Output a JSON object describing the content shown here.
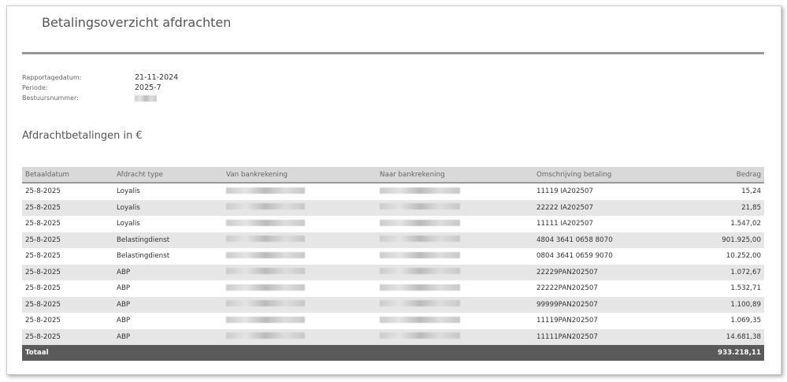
{
  "title": "Betalingsoverzicht afdrachten",
  "meta": {
    "rapportagedatum_label": "Rapportagedatum:",
    "rapportagedatum": "21-11-2024",
    "periode_label": "Periode:",
    "periode": "2025-7",
    "bestuursnummer_label": "Bestuursnummer:"
  },
  "section_title": "Afdrachtbetalingen in €",
  "columns": [
    "Betaaldatum",
    "Afdracht type",
    "Van bankrekening",
    "Naar bankrekening",
    "Omschrijving betaling",
    "Bedrag"
  ],
  "rows": [
    {
      "datum": "25-8-2025",
      "type": "Loyalis",
      "omschrijving": "11119 IA202507",
      "bedrag": "15,24"
    },
    {
      "datum": "25-8-2025",
      "type": "Loyalis",
      "omschrijving": "22222 IA202507",
      "bedrag": "21,85"
    },
    {
      "datum": "25-8-2025",
      "type": "Loyalis",
      "omschrijving": "11111 IA202507",
      "bedrag": "1.547,02"
    },
    {
      "datum": "25-8-2025",
      "type": "Belastingdienst",
      "omschrijving": "4804 3641 0658 8070",
      "bedrag": "901.925,00"
    },
    {
      "datum": "25-8-2025",
      "type": "Belastingdienst",
      "omschrijving": "0804 3641 0659 9070",
      "bedrag": "10.252,00"
    },
    {
      "datum": "25-8-2025",
      "type": "ABP",
      "omschrijving": "22229PAN202507",
      "bedrag": "1.072,67"
    },
    {
      "datum": "25-8-2025",
      "type": "ABP",
      "omschrijving": "22222PAN202507",
      "bedrag": "1.532,71"
    },
    {
      "datum": "25-8-2025",
      "type": "ABP",
      "omschrijving": "99999PAN202507",
      "bedrag": "1.100,89"
    },
    {
      "datum": "25-8-2025",
      "type": "ABP",
      "omschrijving": "11119PAN202507",
      "bedrag": "1.069,35"
    },
    {
      "datum": "25-8-2025",
      "type": "ABP",
      "omschrijving": "11111PAN202507",
      "bedrag": "14.681,38"
    }
  ],
  "total": {
    "label": "Totaal",
    "bedrag": "933.218,11"
  }
}
